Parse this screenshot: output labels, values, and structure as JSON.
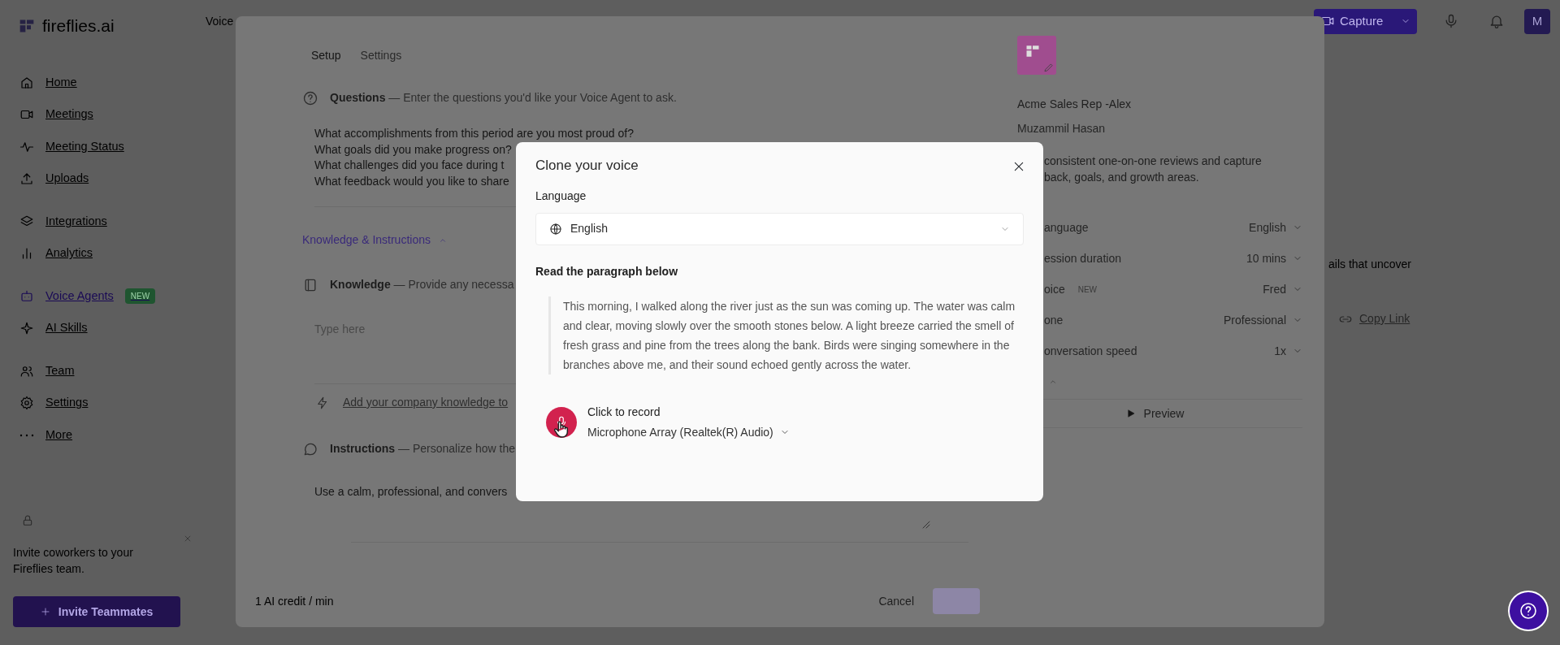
{
  "sidebar": {
    "logo": "fireflies.ai",
    "groups": [
      [
        {
          "label": "Home",
          "selected": false
        },
        {
          "label": "Meetings",
          "selected": false
        },
        {
          "label": "Meeting Status",
          "selected": false
        },
        {
          "label": "Uploads",
          "selected": false
        }
      ],
      [
        {
          "label": "Integrations",
          "selected": false
        },
        {
          "label": "Analytics",
          "selected": false
        }
      ],
      [
        {
          "label": "Voice Agents",
          "selected": true,
          "badge": "NEW"
        },
        {
          "label": "AI Skills",
          "selected": false
        }
      ],
      [
        {
          "label": "Team",
          "selected": false
        },
        {
          "label": "Settings",
          "selected": false
        },
        {
          "label": "More",
          "selected": false
        }
      ]
    ],
    "invite": {
      "text": "Invite coworkers to your Fireflies team.",
      "button": "Invite Teammates"
    }
  },
  "topbar": {
    "title": "Voice",
    "capture_button": "Capture",
    "avatar": "M"
  },
  "background": {
    "text_fragment": "ails that uncover",
    "copy_link": "Copy Link"
  },
  "agent_editor": {
    "tabs": [
      {
        "label": "Setup",
        "selected": true
      },
      {
        "label": "Settings",
        "selected": false
      }
    ],
    "questions": {
      "title": "Questions",
      "hint": "— Enter the questions you'd like your Voice Agent to ask.",
      "lines": [
        "What accomplishments from this period are you most proud of?",
        "What goals did you make progress on?",
        "What challenges did you face during t",
        "What feedback would you like to share"
      ]
    },
    "section_toggle": {
      "label": "Knowledge & Instructions",
      "expanded": true
    },
    "knowledge": {
      "title": "Knowledge",
      "hint": "— Provide any necessa",
      "placeholder": "Type here",
      "add_link": "Add your company knowledge to"
    },
    "instructions": {
      "title": "Instructions",
      "hint": "— Personalize how the",
      "value": "Use a calm, professional, and convers"
    },
    "footer": {
      "credit": "1 AI credit / min",
      "cancel": "Cancel",
      "save_disabled": true
    },
    "agent": {
      "name": "Acme Sales Rep -Alex",
      "owner": "Muzammil Hasan",
      "description": [
        "consistent one-on-one reviews and capture",
        "back, goals, and growth areas."
      ],
      "settings": [
        {
          "label": "anguage",
          "value": "English"
        },
        {
          "label": "ession duration",
          "value": "10 mins"
        },
        {
          "label": "oice",
          "badge": "NEW",
          "value": "Fred"
        },
        {
          "label": "one",
          "value": "Professional"
        },
        {
          "label": "onversation speed",
          "value": "1x"
        }
      ],
      "preview": "Preview"
    }
  },
  "clone_dialog": {
    "title": "Clone your voice",
    "language_label": "Language",
    "language": "English",
    "paragraph_label": "Read the paragraph below",
    "paragraph": "This morning, I walked along the river just as the sun was coming up. The water was calm and clear, moving slowly over the smooth stones below. A light breeze carried the smell of fresh grass and pine from the trees along the bank. Birds were singing somewhere in the branches above me, and their sound echoed gently across the water.",
    "record_label": "Click to record",
    "microphone": "Microphone Array (Realtek(R) Audio)"
  }
}
